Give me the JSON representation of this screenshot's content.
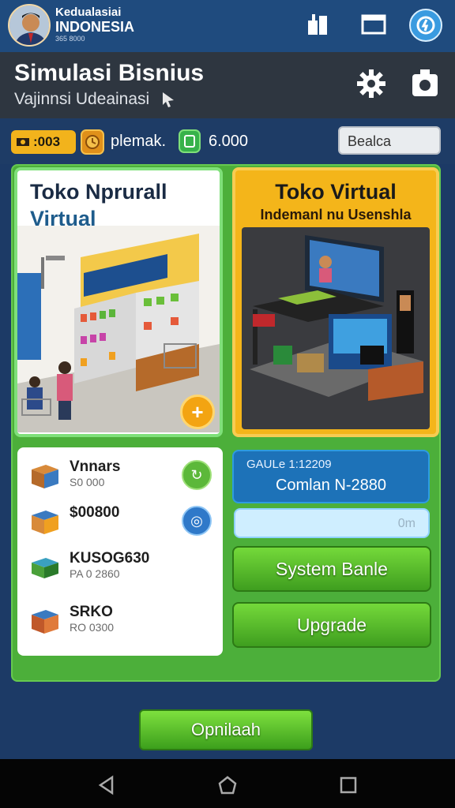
{
  "header": {
    "brand_line1": "Kedualasiai",
    "brand_line2": "INDONESIA",
    "brand_line3": "365 8000"
  },
  "titlebar": {
    "title": "Simulasi Bisnius",
    "subtitle": "Vajinnsi Udeainasi"
  },
  "stats": {
    "coins": ":003",
    "label": "plemak.",
    "money": "6.000",
    "search_value": "Bealca"
  },
  "cards": {
    "left": {
      "title_line1": "Toko Nprurall",
      "title_line2": "Virtual"
    },
    "right": {
      "title_line1": "Toko Virtual",
      "title_line2": "Indemanl nu Usenshla"
    }
  },
  "inventory": [
    {
      "name": "Vnnars",
      "sub": "S0 000",
      "action_color": "#5cb83a"
    },
    {
      "name": "$00800",
      "sub": "",
      "action_color": "#2f79c9"
    },
    {
      "name": "KUSOG630",
      "sub": "PA 0 2860",
      "action_color": ""
    },
    {
      "name": "SRKO",
      "sub": "RO 0300",
      "action_color": ""
    }
  ],
  "info": {
    "line1": "GAULe 1:12209",
    "line2": "Comlan N-2880"
  },
  "progress": {
    "value_text": "0m",
    "fraction": 0.0
  },
  "buttons": {
    "system": "System Banle",
    "upgrade": "Upgrade",
    "bottom": "Opnilaah"
  },
  "colors": {
    "topbar": "#1f4b7e",
    "panel_green": "#4caf3a",
    "accent_yellow": "#f4b51a",
    "accent_blue": "#1d72b8"
  }
}
